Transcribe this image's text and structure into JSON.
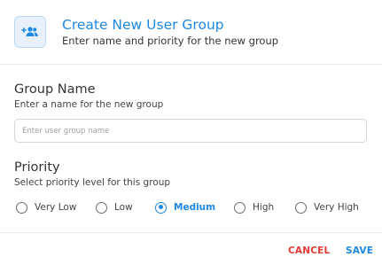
{
  "dialog": {
    "title": "Create New User Group",
    "subtitle": "Enter name and priority for the new group",
    "icon": "add-group-icon"
  },
  "group_name": {
    "title": "Group Name",
    "hint": "Enter a name for the new group",
    "value": "",
    "placeholder": "Enter user group name"
  },
  "priority": {
    "title": "Priority",
    "hint": "Select priority level for this group",
    "options": [
      {
        "label": "Very Low"
      },
      {
        "label": "Low"
      },
      {
        "label": "Medium"
      },
      {
        "label": "High"
      },
      {
        "label": "Very High"
      }
    ],
    "selected": "Medium"
  },
  "actions": {
    "cancel_label": "CANCEL",
    "save_label": "SAVE"
  },
  "colors": {
    "accent": "#1e88e5",
    "danger": "#e53935",
    "icon_bg": "#e8f1fb"
  }
}
